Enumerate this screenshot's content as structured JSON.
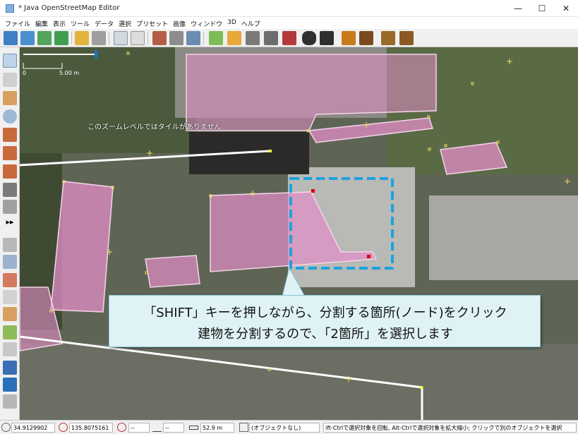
{
  "window": {
    "title": "* Java OpenStreetMap Editor",
    "minimize": "—",
    "maximize": "☐",
    "close": "✕"
  },
  "menu": [
    "ファイル",
    "編集",
    "表示",
    "ツール",
    "データ",
    "選択",
    "プリセット",
    "画像",
    "ウィンドウ",
    "3D",
    "ヘルプ"
  ],
  "map": {
    "scale_start": "0",
    "scale_end": "5.00 m",
    "tile_message": "このズームレベルではタイルがありません"
  },
  "callout": {
    "line1": "「SHIFT」キーを押しながら、分割する箇所(ノード)をクリック",
    "line2": "建物を分割するので、「2箇所」を選択します"
  },
  "statusbar": {
    "latitude": "34.9129902",
    "longitude": "135.8075161",
    "heading": "--",
    "angle": "--",
    "distance": "52.9 m",
    "selection": "(オブジェクトなし)",
    "help": "ift-Ctrlで選択対象を回転, Alt-Ctrlで選択対象を拡大縮小; クリックで別のオブジェクトを選択"
  },
  "colors": {
    "building": "#e38ec8",
    "selection_box": "#1aa3e0",
    "callout_bg": "#dff3f6",
    "node_selected": "#e00000"
  }
}
